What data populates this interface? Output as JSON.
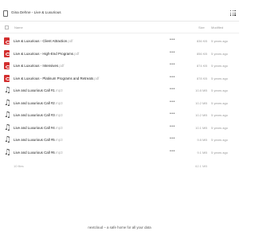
{
  "header": {
    "breadcrumb": "Gina Dehne - Live & Luxurious"
  },
  "table": {
    "columns": {
      "name": "Name",
      "size": "Size",
      "modified": "Modified"
    },
    "rows": [
      {
        "name": "Live & Luxurious - Client Attraction",
        "ext": ".pdf",
        "icon": "pdf-icon",
        "more": "•••",
        "size": "836 KB",
        "modified": "5 years ago"
      },
      {
        "name": "Live & Luxurious - High-End Programs",
        "ext": ".pdf",
        "icon": "pdf-icon",
        "more": "•••",
        "size": "856 KB",
        "modified": "5 years ago"
      },
      {
        "name": "Live & Luxurious - Intensives",
        "ext": ".pdf",
        "icon": "pdf-icon",
        "more": "•••",
        "size": "874 KB",
        "modified": "5 years ago"
      },
      {
        "name": "Live & Luxurious - Platinum Programs and Retreats",
        "ext": ".pdf",
        "icon": "pdf-icon",
        "more": "•••",
        "size": "878 KB",
        "modified": "5 years ago"
      },
      {
        "name": "Live and Luxurious Call #1",
        "ext": ".mp3",
        "icon": "audio-icon",
        "more": "•••",
        "size": "10.8 MB",
        "modified": "5 years ago"
      },
      {
        "name": "Live and Luxurious Call #2",
        "ext": ".mp3",
        "icon": "audio-icon",
        "more": "•••",
        "size": "10.2 MB",
        "modified": "5 years ago"
      },
      {
        "name": "Live and Luxurious Call #3",
        "ext": ".mp3",
        "icon": "audio-icon",
        "more": "•••",
        "size": "10.2 MB",
        "modified": "5 years ago"
      },
      {
        "name": "Live and Luxurious Call #4",
        "ext": ".mp3",
        "icon": "audio-icon",
        "more": "•••",
        "size": "10.1 MB",
        "modified": "5 years ago"
      },
      {
        "name": "Live and Luxurious Call #5",
        "ext": ".mp3",
        "icon": "audio-icon",
        "more": "•••",
        "size": "9.8 MB",
        "modified": "5 years ago"
      },
      {
        "name": "Live and Luxurious Call #6",
        "ext": ".mp3",
        "icon": "audio-icon",
        "more": "•••",
        "size": "9.1 MB",
        "modified": "5 years ago"
      }
    ]
  },
  "summary": {
    "files": "10 files",
    "total": "62.1 MB"
  },
  "footer": {
    "text": "nextcloud – a safe home for all your data"
  },
  "colors": {
    "pdf": "#d32f2f",
    "text": "#222222",
    "muted": "#999999"
  }
}
